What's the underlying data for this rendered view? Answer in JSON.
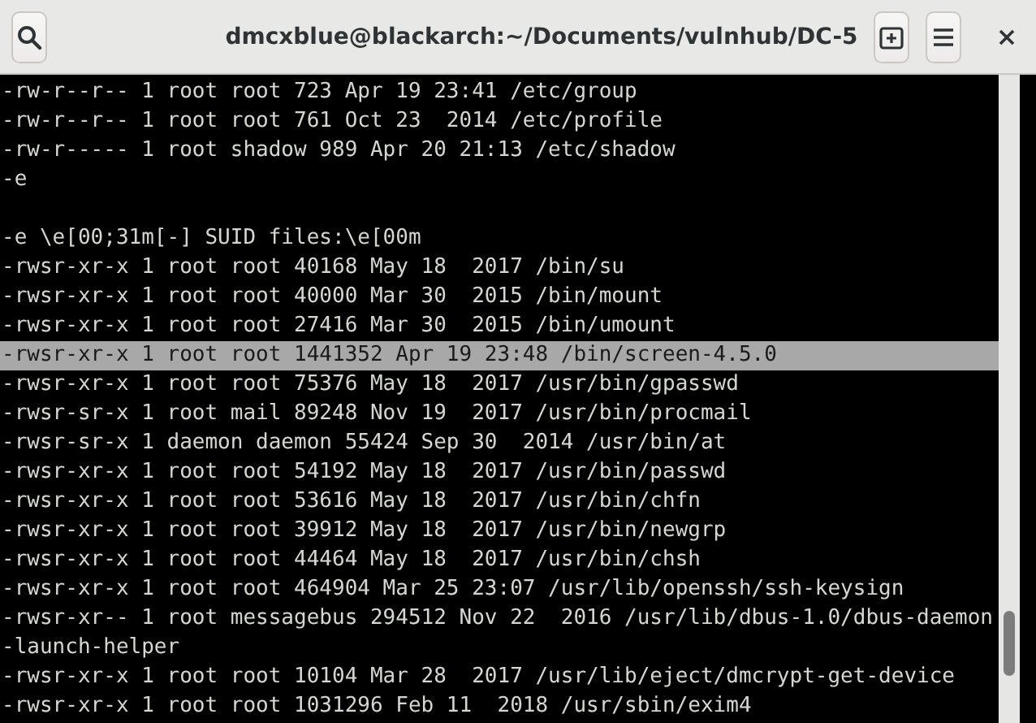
{
  "window": {
    "title": "dmcxblue@blackarch:~/Documents/vulnhub/DC-5"
  },
  "lines": [
    {
      "kind": "text",
      "text": "-rw-r--r-- 1 root root 723 Apr 19 23:41 /etc/group",
      "selected": false
    },
    {
      "kind": "text",
      "text": "-rw-r--r-- 1 root root 761 Oct 23  2014 /etc/profile",
      "selected": false
    },
    {
      "kind": "text",
      "text": "-rw-r----- 1 root shadow 989 Apr 20 21:13 /etc/shadow",
      "selected": false
    },
    {
      "kind": "text",
      "text": "-e",
      "selected": false
    },
    {
      "kind": "blank"
    },
    {
      "kind": "text",
      "text": "-e \\e[00;31m[-] SUID files:\\e[00m",
      "selected": false
    },
    {
      "kind": "text",
      "text": "-rwsr-xr-x 1 root root 40168 May 18  2017 /bin/su",
      "selected": false
    },
    {
      "kind": "text",
      "text": "-rwsr-xr-x 1 root root 40000 Mar 30  2015 /bin/mount",
      "selected": false
    },
    {
      "kind": "text",
      "text": "-rwsr-xr-x 1 root root 27416 Mar 30  2015 /bin/umount",
      "selected": false
    },
    {
      "kind": "text",
      "text": "-rwsr-xr-x 1 root root 1441352 Apr 19 23:48 /bin/screen-4.5.0",
      "selected": true
    },
    {
      "kind": "text",
      "text": "-rwsr-xr-x 1 root root 75376 May 18  2017 /usr/bin/gpasswd",
      "selected": false
    },
    {
      "kind": "text",
      "text": "-rwsr-sr-x 1 root mail 89248 Nov 19  2017 /usr/bin/procmail",
      "selected": false
    },
    {
      "kind": "text",
      "text": "-rwsr-sr-x 1 daemon daemon 55424 Sep 30  2014 /usr/bin/at",
      "selected": false
    },
    {
      "kind": "text",
      "text": "-rwsr-xr-x 1 root root 54192 May 18  2017 /usr/bin/passwd",
      "selected": false
    },
    {
      "kind": "text",
      "text": "-rwsr-xr-x 1 root root 53616 May 18  2017 /usr/bin/chfn",
      "selected": false
    },
    {
      "kind": "text",
      "text": "-rwsr-xr-x 1 root root 39912 May 18  2017 /usr/bin/newgrp",
      "selected": false
    },
    {
      "kind": "text",
      "text": "-rwsr-xr-x 1 root root 44464 May 18  2017 /usr/bin/chsh",
      "selected": false
    },
    {
      "kind": "text",
      "text": "-rwsr-xr-x 1 root root 464904 Mar 25 23:07 /usr/lib/openssh/ssh-keysign",
      "selected": false
    },
    {
      "kind": "text",
      "text": "-rwsr-xr-- 1 root messagebus 294512 Nov 22  2016 /usr/lib/dbus-1.0/dbus-daemon",
      "selected": false
    },
    {
      "kind": "text",
      "text": "-launch-helper",
      "selected": false
    },
    {
      "kind": "text",
      "text": "-rwsr-xr-x 1 root root 10104 Mar 28  2017 /usr/lib/eject/dmcrypt-get-device",
      "selected": false
    },
    {
      "kind": "text",
      "text": "-rwsr-xr-x 1 root root 1031296 Feb 11  2018 /usr/sbin/exim4",
      "selected": false
    }
  ]
}
